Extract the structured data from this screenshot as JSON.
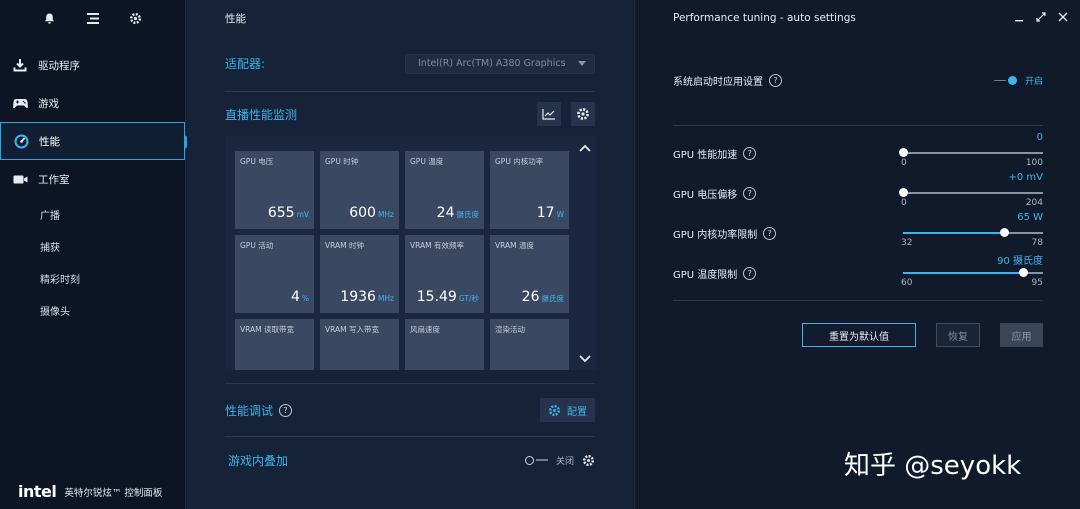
{
  "sidebar": {
    "items": [
      {
        "label": "驱动程序",
        "icon": "download-icon"
      },
      {
        "label": "游戏",
        "icon": "gamepad-icon"
      },
      {
        "label": "性能",
        "icon": "gauge-icon"
      },
      {
        "label": "工作室",
        "icon": "camera-icon"
      }
    ],
    "sub_items": [
      "广播",
      "捕获",
      "精彩时刻",
      "摄像头"
    ],
    "brand_logo": "intel",
    "brand_name": "英特尔锐炫™ 控制面板"
  },
  "middle": {
    "title": "性能",
    "adapter_label": "适配器:",
    "adapter_value": "Intel(R) Arc(TM) A380 Graphics",
    "monitor_title": "直播性能监测",
    "tiles": [
      {
        "name": "GPU 电压",
        "value": "655",
        "unit": "mV"
      },
      {
        "name": "GPU 时钟",
        "value": "600",
        "unit": "MHz"
      },
      {
        "name": "GPU 温度",
        "value": "24",
        "unit": "摄氏度"
      },
      {
        "name": "GPU 内核功率",
        "value": "17",
        "unit": "W"
      },
      {
        "name": "GPU 活动",
        "value": "4",
        "unit": "%"
      },
      {
        "name": "VRAM 时钟",
        "value": "1936",
        "unit": "MHz"
      },
      {
        "name": "VRAM 有效频率",
        "value": "15.49",
        "unit": "GT/秒"
      },
      {
        "name": "VRAM 温度",
        "value": "26",
        "unit": "摄氏度"
      },
      {
        "name": "VRAM 读取带宽",
        "value": "",
        "unit": ""
      },
      {
        "name": "VRAM 写入带宽",
        "value": "",
        "unit": ""
      },
      {
        "name": "风扇速度",
        "value": "",
        "unit": ""
      },
      {
        "name": "渲染活动",
        "value": "",
        "unit": ""
      }
    ],
    "tuning_label": "性能调试",
    "config_label": "配置",
    "overlay_label": "游戏内叠加",
    "overlay_state": "关闭"
  },
  "right": {
    "title": "Performance tuning - auto settings",
    "startup_label": "系统启动时应用设置",
    "startup_state": "开启",
    "sliders": [
      {
        "label": "GPU 性能加速",
        "value": "0",
        "min": "0",
        "max": "100",
        "fraction": 0.0
      },
      {
        "label": "GPU 电压偏移",
        "value": "+0 mV",
        "min": "0",
        "max": "204",
        "fraction": 0.0
      },
      {
        "label": "GPU 内核功率限制",
        "value": "65 W",
        "min": "32",
        "max": "78",
        "fraction": 0.72
      },
      {
        "label": "GPU 温度限制",
        "value": "90 摄氏度",
        "min": "60",
        "max": "95",
        "fraction": 0.86
      }
    ],
    "reset_label": "重置为默认值",
    "restore_label": "恢复",
    "apply_label": "应用"
  },
  "watermark": "知乎 @seyokk",
  "colors": {
    "accent": "#3fb3ea",
    "bg": "#111a2b",
    "panel": "#162238"
  }
}
